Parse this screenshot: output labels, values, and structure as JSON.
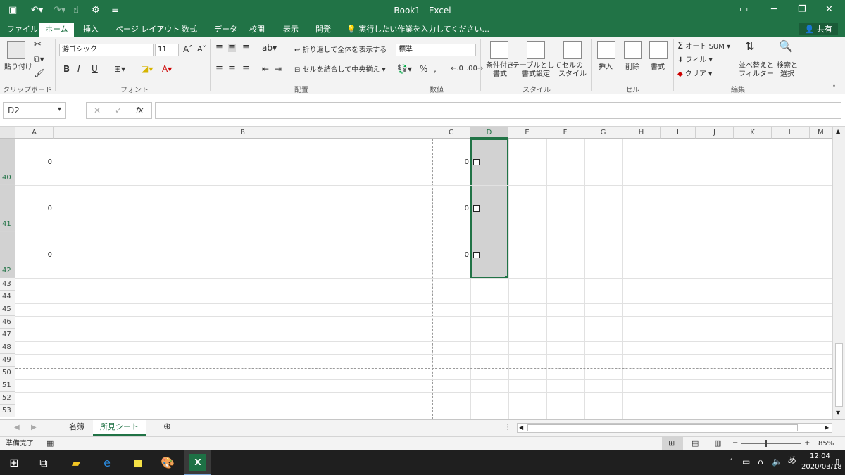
{
  "window": {
    "title": "Book1 - Excel"
  },
  "tabs": [
    "ファイル",
    "ホーム",
    "挿入",
    "ページ レイアウト",
    "数式",
    "データ",
    "校閲",
    "表示",
    "開発"
  ],
  "tell_me": "実行したい作業を入力してください...",
  "share": "共有",
  "ribbon": {
    "clipboard": {
      "paste": "貼り付け",
      "label": "クリップボード"
    },
    "font": {
      "name": "游ゴシック",
      "size": "11",
      "label": "フォント",
      "bold": "B",
      "italic": "I",
      "underline": "U"
    },
    "alignment": {
      "wrap": "折り返して全体を表示する",
      "merge": "セルを結合して中央揃え",
      "label": "配置"
    },
    "number": {
      "format": "標準",
      "label": "数値"
    },
    "styles": {
      "conditional": "条件付き\n書式",
      "table": "テーブルとして\n書式設定",
      "cell": "セルの\nスタイル",
      "label": "スタイル"
    },
    "cells": {
      "insert": "挿入",
      "delete": "削除",
      "format": "書式",
      "label": "セル"
    },
    "editing": {
      "autosum": "オート SUM",
      "fill": "フィル",
      "clear": "クリア",
      "sort": "並べ替えと\nフィルター",
      "find": "検索と\n選択",
      "label": "編集"
    }
  },
  "formula": {
    "namebox": "D2",
    "value": ""
  },
  "columns": [
    "A",
    "B",
    "C",
    "D",
    "E",
    "F",
    "G",
    "H",
    "I",
    "J",
    "K",
    "L",
    "M"
  ],
  "selected_column": "D",
  "rows_tall": [
    {
      "num": "40",
      "a": "0",
      "c": "0"
    },
    {
      "num": "41",
      "a": "0",
      "c": "0"
    },
    {
      "num": "42",
      "a": "0",
      "c": "0"
    }
  ],
  "rows_short": [
    "43",
    "44",
    "45",
    "46",
    "47",
    "48",
    "49",
    "50",
    "51",
    "52",
    "53"
  ],
  "sheets": [
    "名簿",
    "所見シート"
  ],
  "active_sheet": "所見シート",
  "status": {
    "ready": "準備完了",
    "zoom": "85%"
  },
  "clock": {
    "time": "12:04",
    "date": "2020/03/18"
  },
  "ime": "あ",
  "colors": {
    "excel_green": "#217346",
    "selection_fill": "#d2d2d2"
  }
}
